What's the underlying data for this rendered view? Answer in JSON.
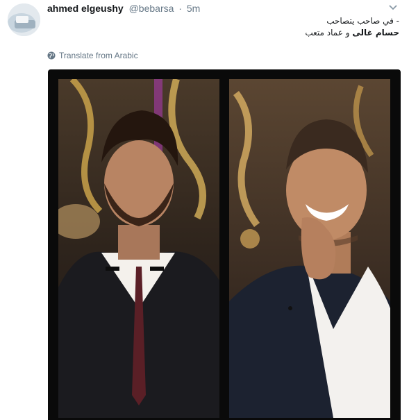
{
  "tweet": {
    "display_name": "ahmed elgeushy",
    "handle": "@bebarsa",
    "separator": "·",
    "time": "5m",
    "text_line1": "- في صاحب يتصاحب",
    "text_line2_bold1": "حسام غالى",
    "text_line2_mid": " و ",
    "text_line2_rest": "عماد متعب",
    "translate_label": "Translate from Arabic"
  },
  "icons": {
    "avatar": "user-avatar",
    "menu": "chevron-down-icon",
    "translate": "globe-icon"
  },
  "colors": {
    "name": "#14171a",
    "secondary": "#657786",
    "media_bg": "#0a0a0a"
  }
}
